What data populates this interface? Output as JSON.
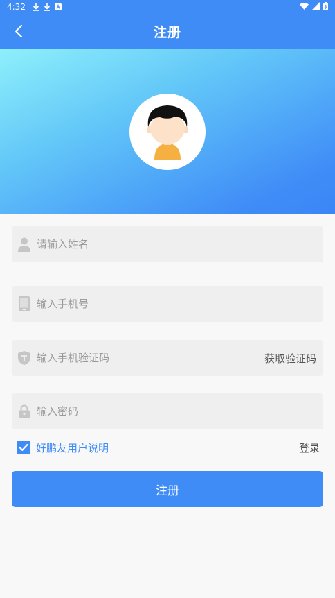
{
  "status_bar": {
    "time": "4:32"
  },
  "header": {
    "title": "注册"
  },
  "form": {
    "name_placeholder": "请输入姓名",
    "phone_placeholder": "输入手机号",
    "code_placeholder": "输入手机验证码",
    "get_code_label": "获取验证码",
    "password_placeholder": "输入密码"
  },
  "agreement": {
    "label": "好鹏友用户说明",
    "checked": true
  },
  "login_label": "登录",
  "submit_label": "注册",
  "colors": {
    "primary": "#3f8cf7",
    "field_bg": "#efefef",
    "page_bg": "#f8f8f8"
  }
}
